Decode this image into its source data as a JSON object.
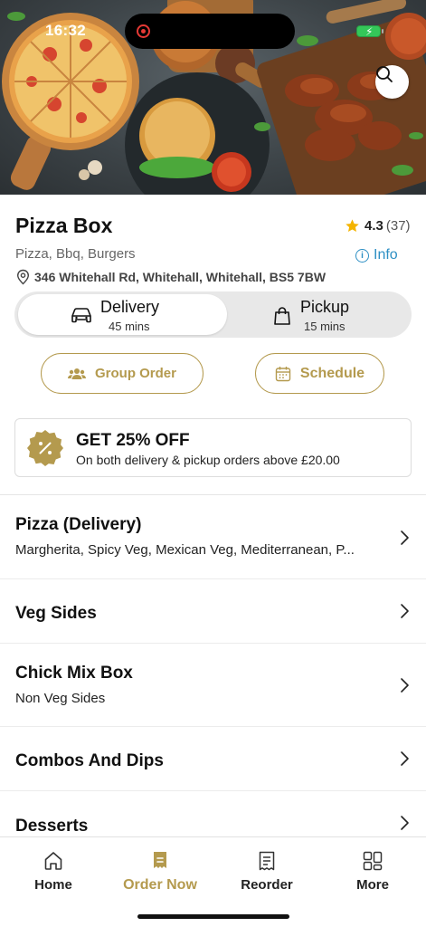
{
  "status_bar": {
    "time": "16:32"
  },
  "store": {
    "name": "Pizza Box",
    "rating": "4.3",
    "rating_count": "(37)",
    "cuisines": "Pizza, Bbq, Burgers",
    "info_label": "Info",
    "address": "346 Whitehall Rd, Whitehall, Whitehall, BS5 7BW"
  },
  "order_modes": [
    {
      "label": "Delivery",
      "time": "45 mins",
      "selected": true,
      "icon": "car-icon"
    },
    {
      "label": "Pickup",
      "time": "15 mins",
      "selected": false,
      "icon": "bag-icon"
    }
  ],
  "actions": {
    "group_order": "Group Order",
    "schedule": "Schedule"
  },
  "offer": {
    "title": "GET 25% OFF",
    "description": "On both delivery & pickup orders above £20.00",
    "icon": "discount-badge-icon"
  },
  "menu_categories": [
    {
      "title": "Pizza (Delivery)",
      "subtitle": "Margherita, Spicy Veg, Mexican Veg, Mediterranean, P..."
    },
    {
      "title": "Veg Sides",
      "subtitle": ""
    },
    {
      "title": "Chick Mix Box",
      "subtitle": "Non Veg Sides"
    },
    {
      "title": "Combos And Dips",
      "subtitle": ""
    },
    {
      "title": "Desserts",
      "subtitle": ""
    }
  ],
  "bottom_nav": [
    {
      "label": "Home",
      "icon": "home-icon",
      "active": false
    },
    {
      "label": "Order Now",
      "icon": "order-icon",
      "active": true
    },
    {
      "label": "Reorder",
      "icon": "receipt-icon",
      "active": false
    },
    {
      "label": "More",
      "icon": "grid-icon",
      "active": false
    }
  ],
  "colors": {
    "accent": "#b49a4e",
    "info_link": "#2d8fc4",
    "rating_star": "#f4b400",
    "battery": "#34c759",
    "record": "#e53935"
  }
}
